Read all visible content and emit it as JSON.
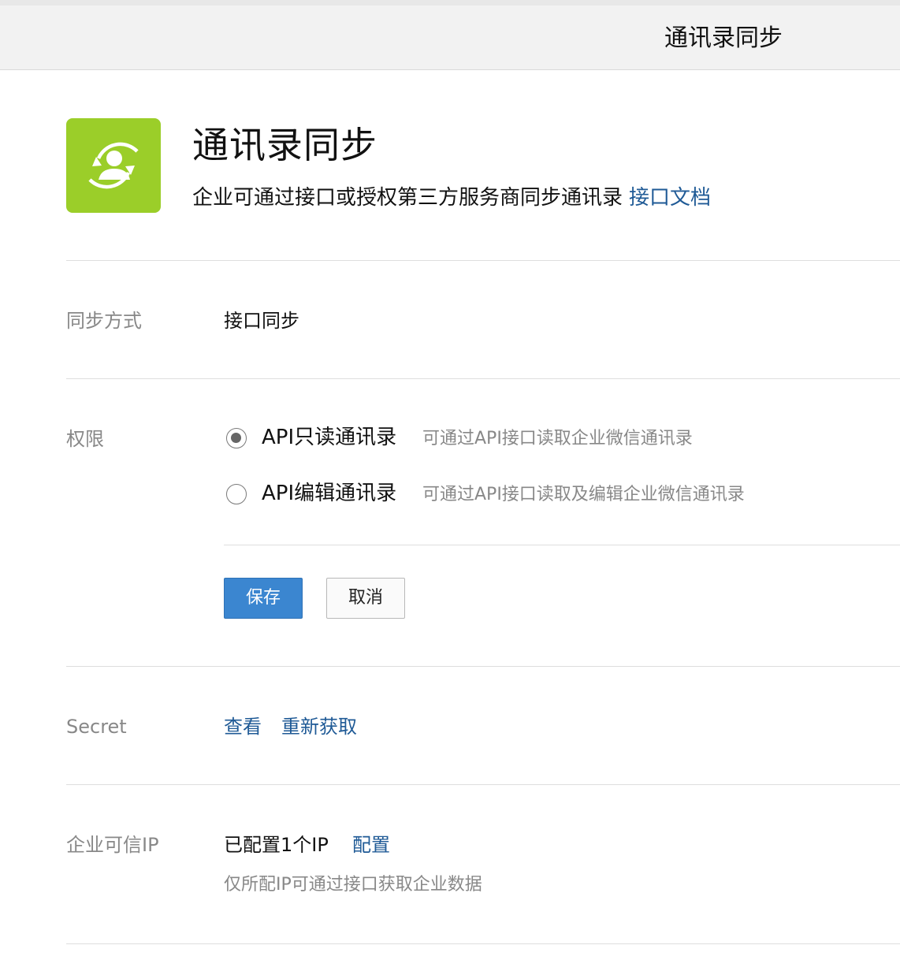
{
  "window": {
    "title": "通讯录同步"
  },
  "app": {
    "title": "通讯录同步",
    "description": "企业可通过接口或授权第三方服务商同步通讯录",
    "doc_link": "接口文档",
    "icon": "contacts-sync-icon",
    "icon_color": "#9bce29"
  },
  "sync_mode": {
    "label": "同步方式",
    "value": "接口同步"
  },
  "permission": {
    "label": "权限",
    "options": [
      {
        "label": "API只读通讯录",
        "hint": "可通过API接口读取企业微信通讯录",
        "selected": true
      },
      {
        "label": "API编辑通讯录",
        "hint": "可通过API接口读取及编辑企业微信通讯录",
        "selected": false
      }
    ],
    "save_label": "保存",
    "cancel_label": "取消"
  },
  "secret": {
    "label": "Secret",
    "view_link": "查看",
    "refetch_link": "重新获取"
  },
  "trusted_ip": {
    "label": "企业可信IP",
    "status": "已配置1个IP",
    "config_link": "配置",
    "hint": "仅所配IP可通过接口获取企业数据"
  },
  "colors": {
    "link": "#1f5a96",
    "primary_button": "#3b86d0",
    "label_gray": "#888888"
  }
}
